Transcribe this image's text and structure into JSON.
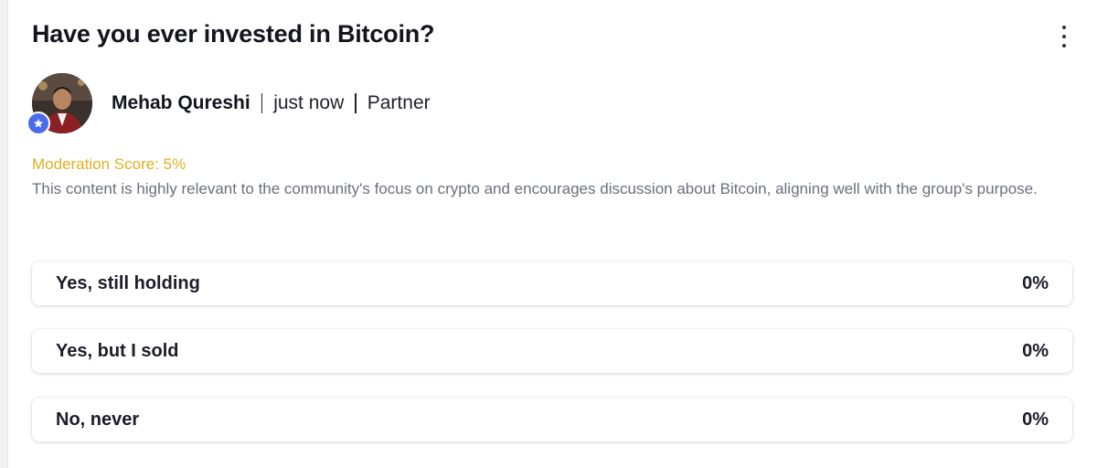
{
  "post": {
    "title": "Have you ever invested in Bitcoin?",
    "menu_icon": "more-vertical-icon"
  },
  "author": {
    "name": "Mehab Qureshi",
    "time": "just now",
    "role": "Partner",
    "badge_icon": "star-icon",
    "badge_color": "#4b6bea"
  },
  "moderation": {
    "score_label": "Moderation Score: 5%",
    "score_color": "#e0b020",
    "description": "This content is highly relevant to the community's focus on crypto and encourages discussion about Bitcoin, aligning well with the group's purpose."
  },
  "poll": {
    "options": [
      {
        "label": "Yes, still holding",
        "percent": "0%"
      },
      {
        "label": "Yes, but I sold",
        "percent": "0%"
      },
      {
        "label": "No, never",
        "percent": "0%"
      }
    ]
  }
}
